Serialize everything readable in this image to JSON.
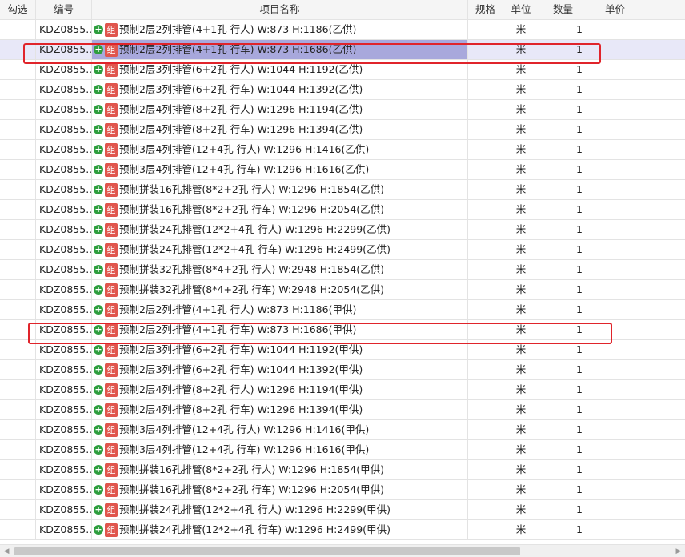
{
  "columns": {
    "select": "勾选",
    "code": "编号",
    "name": "项目名称",
    "spec": "规格",
    "unit": "单位",
    "qty": "数量",
    "price": "单价"
  },
  "badge": "组",
  "rows": [
    {
      "code": "KDZ0855...",
      "name": "预制2层2列排管(4+1孔 行人) W:873 H:1186(乙供)",
      "unit": "米",
      "qty": "1"
    },
    {
      "code": "KDZ0855...",
      "name": "预制2层2列排管(4+1孔 行车) W:873 H:1686(乙供)",
      "unit": "米",
      "qty": "1"
    },
    {
      "code": "KDZ0855...",
      "name": "预制2层3列排管(6+2孔 行人) W:1044 H:1192(乙供)",
      "unit": "米",
      "qty": "1"
    },
    {
      "code": "KDZ0855...",
      "name": "预制2层3列排管(6+2孔 行车) W:1044 H:1392(乙供)",
      "unit": "米",
      "qty": "1"
    },
    {
      "code": "KDZ0855...",
      "name": "预制2层4列排管(8+2孔 行人) W:1296 H:1194(乙供)",
      "unit": "米",
      "qty": "1"
    },
    {
      "code": "KDZ0855...",
      "name": "预制2层4列排管(8+2孔 行车) W:1296 H:1394(乙供)",
      "unit": "米",
      "qty": "1"
    },
    {
      "code": "KDZ0855...",
      "name": "预制3层4列排管(12+4孔 行人) W:1296 H:1416(乙供)",
      "unit": "米",
      "qty": "1"
    },
    {
      "code": "KDZ0855...",
      "name": "预制3层4列排管(12+4孔 行车) W:1296 H:1616(乙供)",
      "unit": "米",
      "qty": "1"
    },
    {
      "code": "KDZ0855...",
      "name": "预制拼装16孔排管(8*2+2孔 行人) W:1296 H:1854(乙供)",
      "unit": "米",
      "qty": "1"
    },
    {
      "code": "KDZ0855...",
      "name": "预制拼装16孔排管(8*2+2孔 行车) W:1296 H:2054(乙供)",
      "unit": "米",
      "qty": "1"
    },
    {
      "code": "KDZ0855...",
      "name": "预制拼装24孔排管(12*2+4孔 行人) W:1296 H:2299(乙供)",
      "unit": "米",
      "qty": "1"
    },
    {
      "code": "KDZ0855...",
      "name": "预制拼装24孔排管(12*2+4孔 行车) W:1296 H:2499(乙供)",
      "unit": "米",
      "qty": "1"
    },
    {
      "code": "KDZ0855...",
      "name": "预制拼装32孔排管(8*4+2孔 行人) W:2948 H:1854(乙供)",
      "unit": "米",
      "qty": "1"
    },
    {
      "code": "KDZ0855...",
      "name": "预制拼装32孔排管(8*4+2孔 行车) W:2948 H:2054(乙供)",
      "unit": "米",
      "qty": "1"
    },
    {
      "code": "KDZ0855...",
      "name": "预制2层2列排管(4+1孔 行人) W:873 H:1186(甲供)",
      "unit": "米",
      "qty": "1"
    },
    {
      "code": "KDZ0855...",
      "name": "预制2层2列排管(4+1孔 行车) W:873 H:1686(甲供)",
      "unit": "米",
      "qty": "1"
    },
    {
      "code": "KDZ0855...",
      "name": "预制2层3列排管(6+2孔 行车) W:1044 H:1192(甲供)",
      "unit": "米",
      "qty": "1"
    },
    {
      "code": "KDZ0855...",
      "name": "预制2层3列排管(6+2孔 行车) W:1044 H:1392(甲供)",
      "unit": "米",
      "qty": "1"
    },
    {
      "code": "KDZ0855...",
      "name": "预制2层4列排管(8+2孔 行人) W:1296 H:1194(甲供)",
      "unit": "米",
      "qty": "1"
    },
    {
      "code": "KDZ0855...",
      "name": "预制2层4列排管(8+2孔 行车) W:1296 H:1394(甲供)",
      "unit": "米",
      "qty": "1"
    },
    {
      "code": "KDZ0855...",
      "name": "预制3层4列排管(12+4孔 行人) W:1296 H:1416(甲供)",
      "unit": "米",
      "qty": "1"
    },
    {
      "code": "KDZ0855...",
      "name": "预制3层4列排管(12+4孔 行车) W:1296 H:1616(甲供)",
      "unit": "米",
      "qty": "1"
    },
    {
      "code": "KDZ0855...",
      "name": "预制拼装16孔排管(8*2+2孔 行人) W:1296 H:1854(甲供)",
      "unit": "米",
      "qty": "1"
    },
    {
      "code": "KDZ0855...",
      "name": "预制拼装16孔排管(8*2+2孔 行车) W:1296 H:2054(甲供)",
      "unit": "米",
      "qty": "1"
    },
    {
      "code": "KDZ0855...",
      "name": "预制拼装24孔排管(12*2+4孔 行人) W:1296 H:2299(甲供)",
      "unit": "米",
      "qty": "1"
    },
    {
      "code": "KDZ0855...",
      "name": "预制拼装24孔排管(12*2+4孔 行车) W:1296 H:2499(甲供)",
      "unit": "米",
      "qty": "1"
    }
  ],
  "selected_row": 1,
  "highlighted_rows": [
    1,
    15
  ],
  "colors": {
    "selected_row": "#e8e8f8",
    "selected_cell": "#a8a8dc",
    "highlight_border": "#e0242b",
    "badge": "#e0554d",
    "plus_icon": "#2e9e3e"
  },
  "icons": [
    "plus-circle-icon",
    "group-badge-icon",
    "scroll-left-arrow-icon",
    "scroll-right-arrow-icon"
  ]
}
